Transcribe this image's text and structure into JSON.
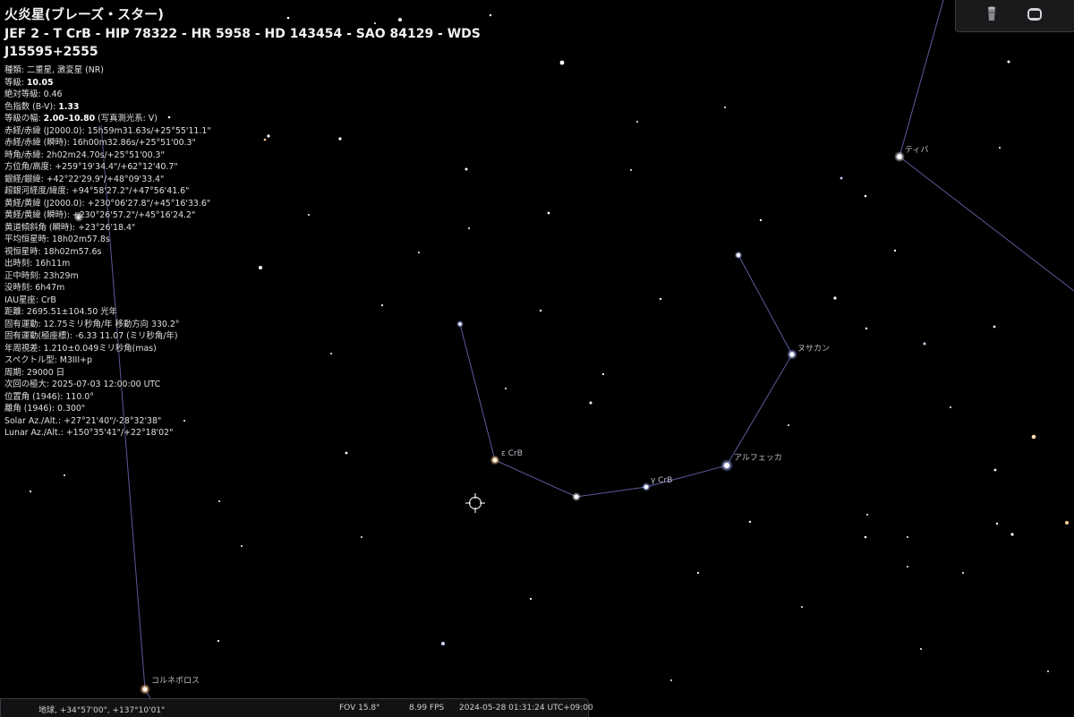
{
  "object": {
    "name": "火炎星(ブレーズ・スター)",
    "identifiers": "JEF 2 - T CrB - HIP 78322 - HR 5958 - HD 143454 - SAO 84129 - WDS J15595+2555",
    "info_lines": [
      {
        "label": "種類: ",
        "value": "二重星, 激変星 (NR)"
      },
      {
        "label": "等級: ",
        "bold": "10.05",
        "value": ""
      },
      {
        "label": "絶対等級: ",
        "value": "0.46"
      },
      {
        "label": "色指数 (B-V): ",
        "bold": "1.33",
        "value": ""
      },
      {
        "label": "等級の幅: ",
        "bold": "2.00–10.80",
        "value": " (写真測光系: V)"
      },
      {
        "label": "赤経/赤緯 (J2000.0): ",
        "value": "15h59m31.63s/+25°55'11.1\""
      },
      {
        "label": "赤経/赤緯 (瞬時): ",
        "value": "16h00m32.86s/+25°51'00.3\""
      },
      {
        "label": "時角/赤緯: ",
        "value": "2h02m24.70s/+25°51'00.3\""
      },
      {
        "label": "方位角/高度: ",
        "value": "+259°19'34.4\"/+62°12'40.7\""
      },
      {
        "label": "銀経/銀緯: ",
        "value": "+42°22'29.9\"/+48°09'33.4\""
      },
      {
        "label": "超銀河経度/緯度: ",
        "value": "+94°58'27.2\"/+47°56'41.6\""
      },
      {
        "label": "黄経/黄緯 (J2000.0): ",
        "value": "+230°06'27.8\"/+45°16'33.6\""
      },
      {
        "label": "黄経/黄緯 (瞬時): ",
        "value": "+230°26'57.2\"/+45°16'24.2\""
      },
      {
        "label": "黄道傾斜角 (瞬時): ",
        "value": "+23°26'18.4\""
      },
      {
        "label": "平均恒星時: ",
        "value": "18h02m57.8s"
      },
      {
        "label": "視恒星時: ",
        "value": "18h02m57.6s"
      },
      {
        "label": "出時刻: ",
        "value": "16h11m"
      },
      {
        "label": "正中時刻: ",
        "value": "23h29m"
      },
      {
        "label": "没時刻: ",
        "value": "6h47m"
      },
      {
        "label": "IAU星座: ",
        "value": "CrB"
      },
      {
        "label": "距離: ",
        "value": "2695.51±104.50 光年"
      },
      {
        "label": "固有運動: ",
        "value": "12.75ミリ秒角/年 移動方向 330.2°"
      },
      {
        "label": "固有運動(極座標): ",
        "value": "-6.33 11.07 (ミリ秒角/年)"
      },
      {
        "label": "年周視差: ",
        "value": "1.210±0.049ミリ秒角(mas)"
      },
      {
        "label": "スペクトル型: ",
        "value": "M3III+p"
      },
      {
        "label": "周期: ",
        "value": "29000 日"
      },
      {
        "label": "次回の極大: ",
        "value": "2025-07-03 12:00:00 UTC"
      },
      {
        "label": "位置角 (1946): ",
        "value": "110.0°"
      },
      {
        "label": "離角 (1946): ",
        "value": "0.300\""
      },
      {
        "label": "Solar Az./Alt.: ",
        "value": "+27°21'40\"/-28°32'38\""
      },
      {
        "label": "Lunar Az./Alt.: ",
        "value": "+150°35'41\"/+22°18'02\""
      }
    ]
  },
  "star_labels": {
    "epsilon_crb": "ε CrB",
    "gamma_crb": "γ CrB",
    "alphecca": "アルフェッカ",
    "nusakan": "ヌサカン",
    "tiaki": "ティバ",
    "kornephoros": "コルネポロス"
  },
  "status_bar": {
    "location": "地球, +34°57'00\", +137°10'01\"",
    "fov": "FOV 15.8°",
    "fps": "8.99 FPS",
    "datetime": "2024-05-28 01:31:24 UTC+09:00"
  },
  "toolbar": {
    "icons": [
      "telescope-icon",
      "screen-icon"
    ]
  },
  "colors": {
    "background": "#000000",
    "constellation_line": "#5a5a9a",
    "label": "#bcbcc8",
    "star": "#ffffff"
  }
}
